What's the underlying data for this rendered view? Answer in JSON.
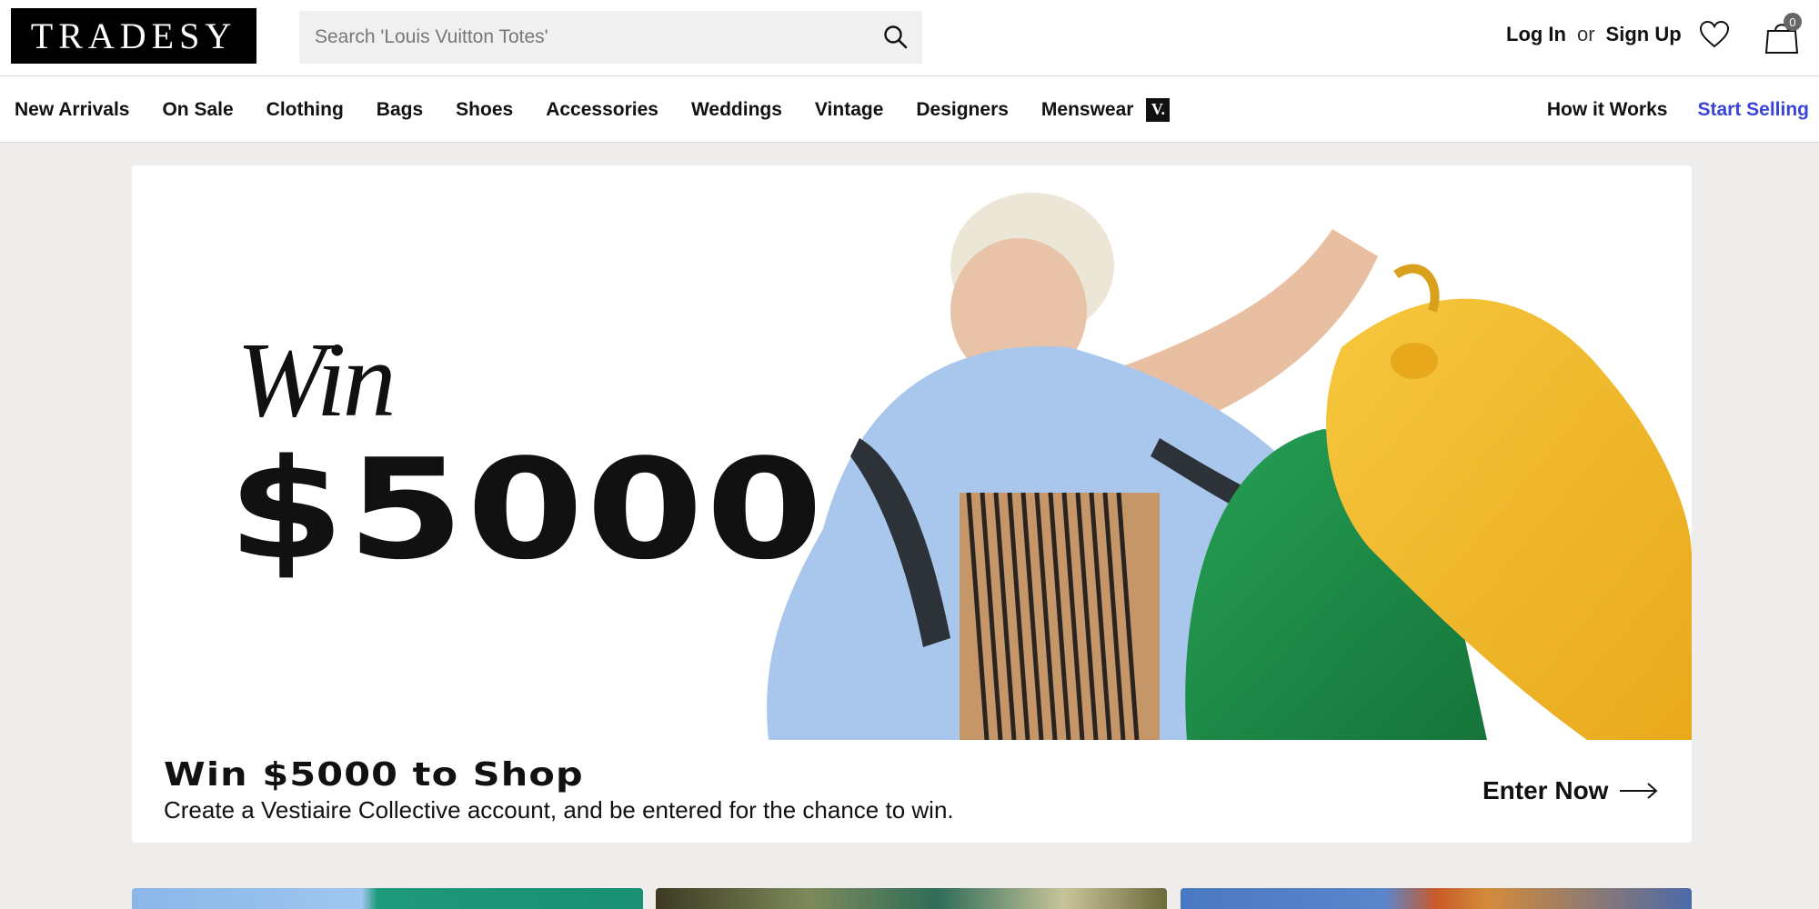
{
  "header": {
    "logo": "TRADESY",
    "search_placeholder": "Search 'Louis Vuitton Totes'",
    "login_label": "Log In",
    "or_label": "or",
    "signup_label": "Sign Up",
    "cart_count": "0"
  },
  "nav": {
    "items": [
      "New Arrivals",
      "On Sale",
      "Clothing",
      "Bags",
      "Shoes",
      "Accessories",
      "Weddings",
      "Vintage",
      "Designers",
      "Menswear"
    ],
    "badge": "V.",
    "how_it_works": "How it Works",
    "start_selling": "Start Selling"
  },
  "hero": {
    "win_word": "Win",
    "amount": "$5000",
    "title": "Win $5000 to Shop",
    "subtitle": "Create a Vestiaire Collective account, and be entered for the chance to win.",
    "cta_label": "Enter Now"
  },
  "colors": {
    "accent": "#3a45d8",
    "bag_yellow": "#f0b928",
    "bag_green": "#1f8a46",
    "sweater_blue": "#a9c7ec"
  }
}
